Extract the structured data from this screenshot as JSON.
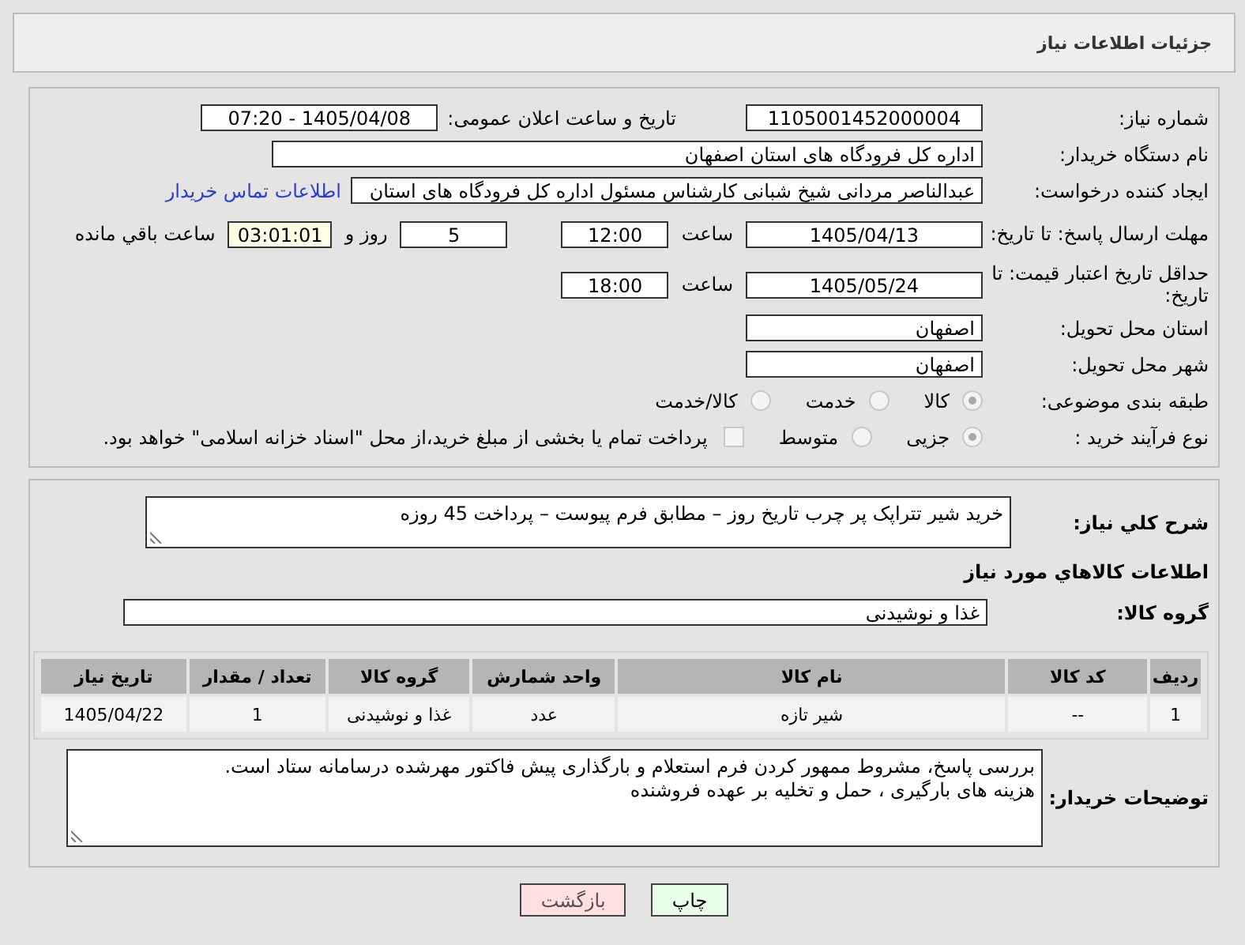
{
  "header": {
    "title": "جزئیات اطلاعات نیاز"
  },
  "need_number": {
    "label": "شماره نیاز:",
    "value": "1105001452000004"
  },
  "announce": {
    "label": "تاریخ و ساعت اعلان عمومی:",
    "value": "1405/04/08 - 07:20"
  },
  "buyer": {
    "label": "نام دستگاه خریدار:",
    "value": "اداره کل فرودگاه های استان اصفهان"
  },
  "creator": {
    "label": "ایجاد کننده درخواست:",
    "value": "عبدالناصر مردانی شیخ شبانی کارشناس مسئول  اداره کل فرودگاه های استان",
    "link": "اطلاعات تماس خریدار"
  },
  "deadline": {
    "label": "مهلت ارسال پاسخ: تا تاریخ:",
    "date": "1405/04/13",
    "time_label": "ساعت",
    "time": "12:00",
    "days": "5",
    "days_label": "روز و",
    "remaining": "03:01:01",
    "remaining_label": "ساعت باقي مانده"
  },
  "validity": {
    "label": "حداقل تاریخ اعتبار قیمت: تا تاریخ:",
    "date": "1405/05/24",
    "time_label": "ساعت",
    "time": "18:00"
  },
  "province": {
    "label": "استان محل تحویل:",
    "value": "اصفهان"
  },
  "city": {
    "label": "شهر محل تحویل:",
    "value": "اصفهان"
  },
  "category": {
    "label": "طبقه بندی موضوعی:",
    "options": [
      {
        "label": "کالا",
        "selected": true
      },
      {
        "label": "خدمت",
        "selected": false
      },
      {
        "label": "کالا/خدمت",
        "selected": false
      }
    ]
  },
  "process": {
    "label": "نوع فرآیند خرید :",
    "options": [
      {
        "label": "جزیی",
        "selected": true
      },
      {
        "label": "متوسط",
        "selected": false
      }
    ],
    "payment": {
      "checked": false,
      "text": "پرداخت تمام یا بخشی از مبلغ خرید،از محل \"اسناد خزانه اسلامی\" خواهد بود."
    }
  },
  "description": {
    "label": "شرح کلي نیاز:",
    "value": "خرید شیر تتراپک پر چرب تاریخ روز  – مطابق فرم پیوست – پرداخت 45 روزه"
  },
  "goods_heading": "اطلاعات کالاهاي مورد نياز",
  "goods_group": {
    "label": "گروه کالا:",
    "value": "غذا و نوشیدنی"
  },
  "table": {
    "columns": [
      "ردیف",
      "کد کالا",
      "نام کالا",
      "واحد شمارش",
      "گروه کالا",
      "تعداد / مقدار",
      "تاریخ نیاز"
    ],
    "rows": [
      [
        "1",
        "--",
        "شیر تازه",
        "عدد",
        "غذا و نوشیدنی",
        "1",
        "1405/04/22"
      ]
    ]
  },
  "buyer_notes": {
    "label": "توضیحات خریدار:",
    "lines": [
      "بررسی پاسخ، مشروط ممهور کردن فرم استعلام و  بارگذاری پیش فاکتور مهرشده   درسامانه  ستاد است.",
      "هزینه های بارگیری ، حمل و تخلیه بر عهده فروشنده"
    ]
  },
  "buttons": [
    {
      "label": "چاپ",
      "kind": "print"
    },
    {
      "label": "بازگشت",
      "kind": "back"
    }
  ]
}
